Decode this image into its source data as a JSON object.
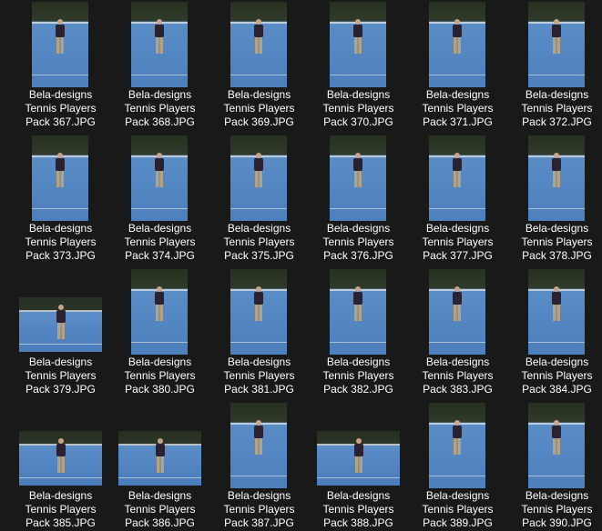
{
  "files": [
    {
      "line1": "Bela-designs",
      "line2": "Tennis Players",
      "line3": "Pack 367.JPG",
      "orientation": "portrait"
    },
    {
      "line1": "Bela-designs",
      "line2": "Tennis Players",
      "line3": "Pack 368.JPG",
      "orientation": "portrait"
    },
    {
      "line1": "Bela-designs",
      "line2": "Tennis Players",
      "line3": "Pack 369.JPG",
      "orientation": "portrait"
    },
    {
      "line1": "Bela-designs",
      "line2": "Tennis Players",
      "line3": "Pack 370.JPG",
      "orientation": "portrait"
    },
    {
      "line1": "Bela-designs",
      "line2": "Tennis Players",
      "line3": "Pack 371.JPG",
      "orientation": "portrait"
    },
    {
      "line1": "Bela-designs",
      "line2": "Tennis Players",
      "line3": "Pack 372.JPG",
      "orientation": "portrait"
    },
    {
      "line1": "Bela-designs",
      "line2": "Tennis Players",
      "line3": "Pack 373.JPG",
      "orientation": "portrait"
    },
    {
      "line1": "Bela-designs",
      "line2": "Tennis Players",
      "line3": "Pack 374.JPG",
      "orientation": "portrait"
    },
    {
      "line1": "Bela-designs",
      "line2": "Tennis Players",
      "line3": "Pack 375.JPG",
      "orientation": "portrait"
    },
    {
      "line1": "Bela-designs",
      "line2": "Tennis Players",
      "line3": "Pack 376.JPG",
      "orientation": "portrait"
    },
    {
      "line1": "Bela-designs",
      "line2": "Tennis Players",
      "line3": "Pack 377.JPG",
      "orientation": "portrait"
    },
    {
      "line1": "Bela-designs",
      "line2": "Tennis Players",
      "line3": "Pack 378.JPG",
      "orientation": "portrait"
    },
    {
      "line1": "Bela-designs",
      "line2": "Tennis Players",
      "line3": "Pack 379.JPG",
      "orientation": "landscape"
    },
    {
      "line1": "Bela-designs",
      "line2": "Tennis Players",
      "line3": "Pack 380.JPG",
      "orientation": "portrait"
    },
    {
      "line1": "Bela-designs",
      "line2": "Tennis Players",
      "line3": "Pack 381.JPG",
      "orientation": "portrait"
    },
    {
      "line1": "Bela-designs",
      "line2": "Tennis Players",
      "line3": "Pack 382.JPG",
      "orientation": "portrait"
    },
    {
      "line1": "Bela-designs",
      "line2": "Tennis Players",
      "line3": "Pack 383.JPG",
      "orientation": "portrait"
    },
    {
      "line1": "Bela-designs",
      "line2": "Tennis Players",
      "line3": "Pack 384.JPG",
      "orientation": "portrait"
    },
    {
      "line1": "Bela-designs",
      "line2": "Tennis Players",
      "line3": "Pack 385.JPG",
      "orientation": "landscape"
    },
    {
      "line1": "Bela-designs",
      "line2": "Tennis Players",
      "line3": "Pack 386.JPG",
      "orientation": "landscape"
    },
    {
      "line1": "Bela-designs",
      "line2": "Tennis Players",
      "line3": "Pack 387.JPG",
      "orientation": "portrait"
    },
    {
      "line1": "Bela-designs",
      "line2": "Tennis Players",
      "line3": "Pack 388.JPG",
      "orientation": "landscape"
    },
    {
      "line1": "Bela-designs",
      "line2": "Tennis Players",
      "line3": "Pack 389.JPG",
      "orientation": "portrait"
    },
    {
      "line1": "Bela-designs",
      "line2": "Tennis Players",
      "line3": "Pack 390.JPG",
      "orientation": "portrait"
    }
  ]
}
